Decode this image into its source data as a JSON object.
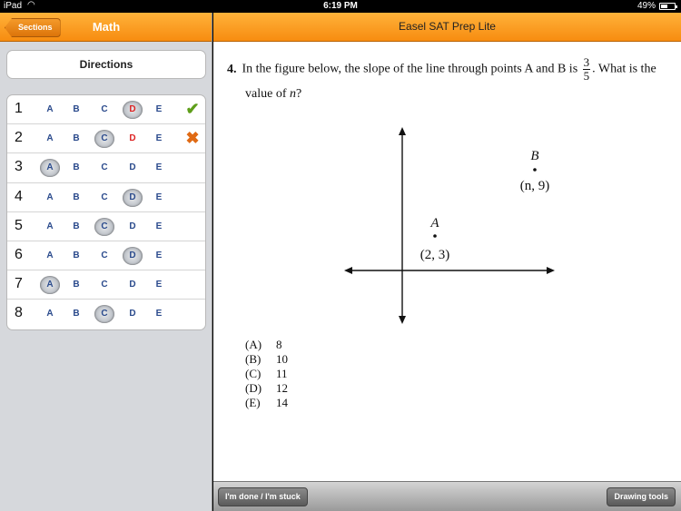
{
  "status": {
    "device": "iPad",
    "time": "6:19 PM",
    "battery": "49%",
    "battery_level": 0.49
  },
  "left": {
    "back_label": "Sections",
    "title": "Math",
    "directions_label": "Directions",
    "choice_letters": [
      "A",
      "B",
      "C",
      "D",
      "E"
    ],
    "questions": [
      {
        "num": "1",
        "selected": "D",
        "result": "correct"
      },
      {
        "num": "2",
        "selected": "C",
        "result": "incorrect",
        "correct": "D"
      },
      {
        "num": "3",
        "selected": "A",
        "result": ""
      },
      {
        "num": "4",
        "selected": "D",
        "result": ""
      },
      {
        "num": "5",
        "selected": "C",
        "result": ""
      },
      {
        "num": "6",
        "selected": "D",
        "result": ""
      },
      {
        "num": "7",
        "selected": "A",
        "result": ""
      },
      {
        "num": "8",
        "selected": "C",
        "result": ""
      }
    ]
  },
  "right": {
    "header_title": "Easel SAT Prep Lite",
    "question": {
      "number": "4.",
      "text_before": "In the figure below, the slope of the line through points A and B is",
      "fraction_num": "3",
      "fraction_den": "5",
      "text_after": ". What is the",
      "line2_before": "value of ",
      "line2_var": "n",
      "line2_after": "?"
    },
    "figure": {
      "point_a_name": "A",
      "point_a_coords": "(2, 3)",
      "point_b_name": "B",
      "point_b_coords": "(n, 9)"
    },
    "answers": [
      {
        "letter": "(A)",
        "value": "8"
      },
      {
        "letter": "(B)",
        "value": "10"
      },
      {
        "letter": "(C)",
        "value": "11"
      },
      {
        "letter": "(D)",
        "value": "12"
      },
      {
        "letter": "(E)",
        "value": "14"
      }
    ],
    "done_label": "I'm done / I'm stuck",
    "drawing_label": "Drawing tools"
  }
}
